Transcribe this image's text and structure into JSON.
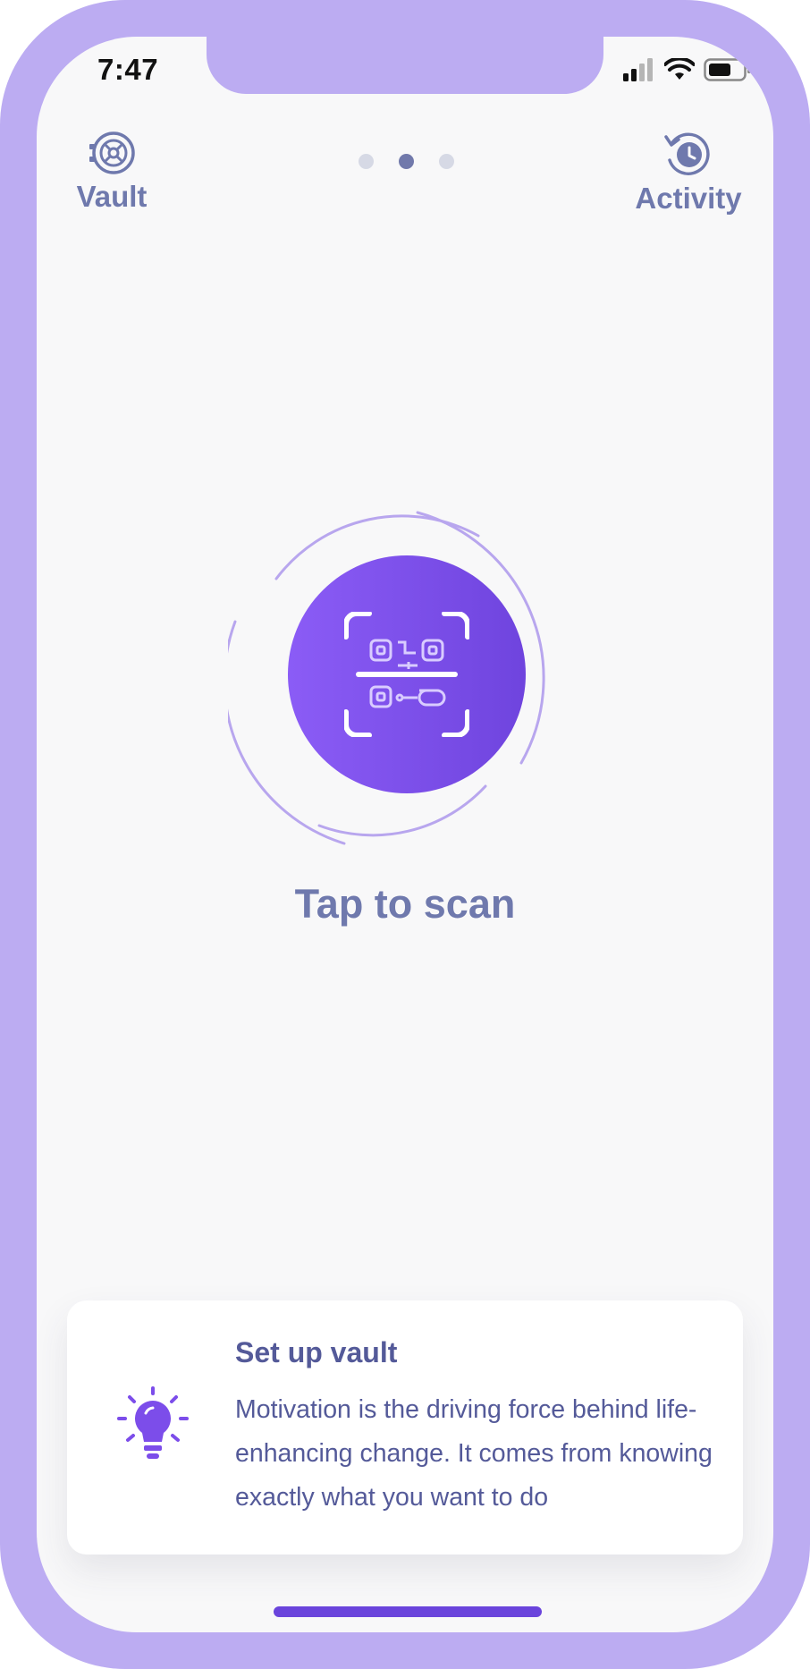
{
  "status_bar": {
    "time": "7:47"
  },
  "top_nav": {
    "vault_label": "Vault",
    "activity_label": "Activity",
    "page_count": 3,
    "active_page": 2
  },
  "scan": {
    "label": "Tap to scan"
  },
  "tip_card": {
    "title": "Set up vault",
    "body": "Motivation is the driving force behind life-enhancing change. It comes from knowing exactly what you want to do"
  },
  "colors": {
    "frame": "#bcacf2",
    "screen_bg": "#f8f8f9",
    "accent": "#7c4dea",
    "nav_text": "#6f79ad",
    "card_text": "#545a99",
    "dot_inactive": "#d6d9e5",
    "dot_active": "#7179ab"
  },
  "icons": {
    "vault": "vault-icon",
    "activity": "activity-icon",
    "scan": "qr-scan-icon",
    "tip": "lightbulb-icon"
  }
}
